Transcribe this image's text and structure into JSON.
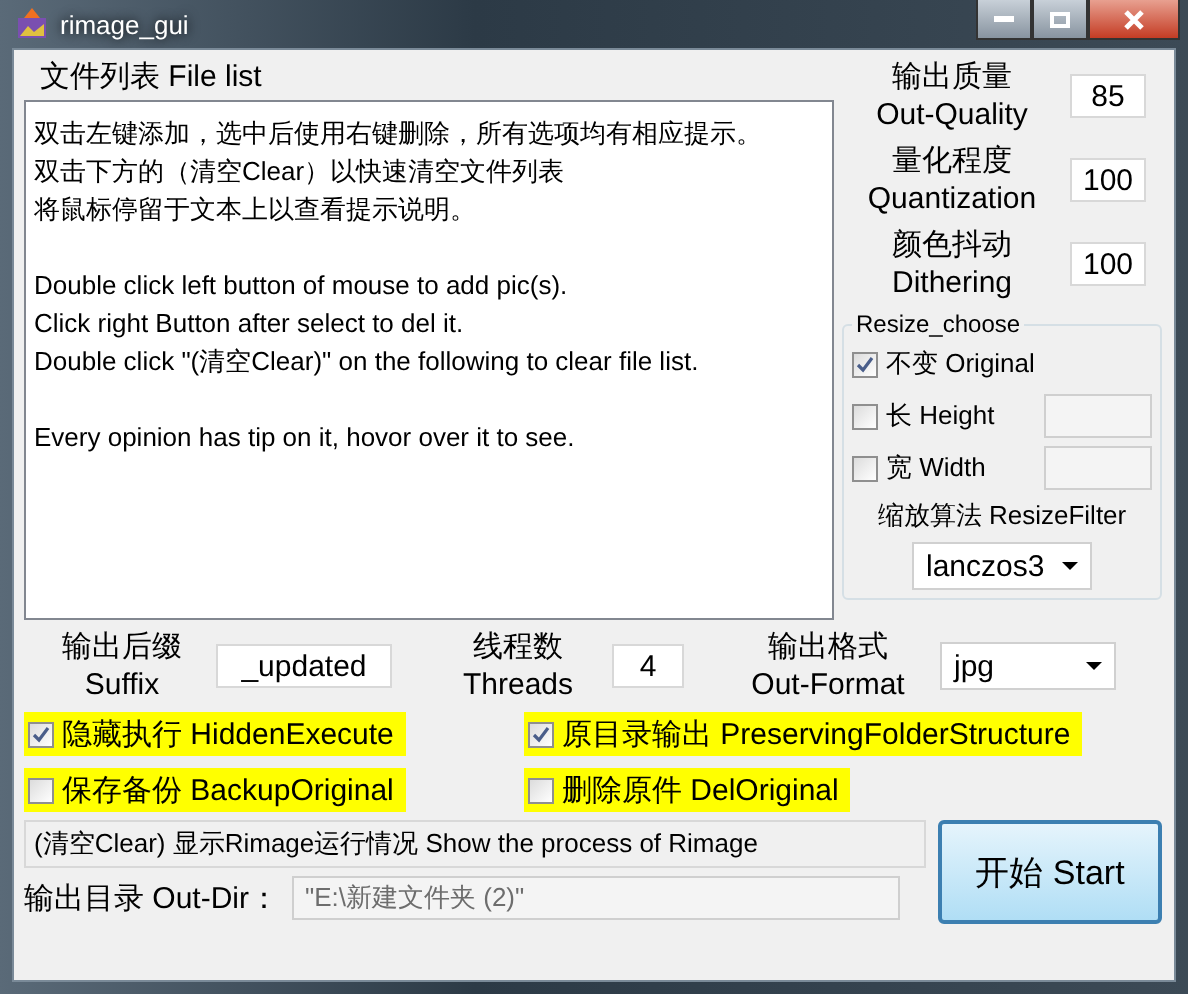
{
  "window": {
    "title": "rimage_gui"
  },
  "file_list": {
    "label": "文件列表 File list",
    "paragraphs": [
      [
        "双击左键添加，选中后使用右键删除，所有选项均有相应提示。",
        "双击下方的（清空Clear）以快速清空文件列表",
        "将鼠标停留于文本上以查看提示说明。"
      ],
      [
        "Double click left button of mouse to add pic(s).",
        "Click right Button after select to del it.",
        "Double click \"(清空Clear)\" on the following to clear file list."
      ],
      [
        "Every opinion has tip on it, hovor over it to see."
      ]
    ]
  },
  "params": [
    {
      "label_cn": "输出质量",
      "label_en": "Out-Quality",
      "value": "85"
    },
    {
      "label_cn": "量化程度",
      "label_en": "Quantization",
      "value": "100"
    },
    {
      "label_cn": "颜色抖动",
      "label_en": "Dithering",
      "value": "100"
    }
  ],
  "resize": {
    "title": "Resize_choose",
    "options": [
      {
        "label": "不变 Original",
        "checked": true,
        "kind": "plain"
      },
      {
        "label": "长 Height",
        "checked": false,
        "kind": "input"
      },
      {
        "label": "宽 Width",
        "checked": false,
        "kind": "input"
      }
    ],
    "filter_label": "缩放算法 ResizeFilter",
    "filter_value": "lanczos3"
  },
  "outputs": [
    {
      "label_cn": "输出后缀",
      "label_en": "Suffix",
      "value": "_updated",
      "kind": "input"
    },
    {
      "label_cn": "线程数",
      "label_en": "Threads",
      "value": "4",
      "kind": "input"
    },
    {
      "label_cn": "输出格式",
      "label_en": "Out-Format",
      "value": "jpg",
      "kind": "select"
    }
  ],
  "options": [
    {
      "label": "隐藏执行 HiddenExecute",
      "checked": true
    },
    {
      "label": "原目录输出 PreservingFolderStructure",
      "checked": true
    },
    {
      "label": "保存备份 BackupOriginal",
      "checked": false
    },
    {
      "label": "删除原件 DelOriginal",
      "checked": false
    }
  ],
  "status": "(清空Clear) 显示Rimage运行情况 Show the process of Rimage",
  "out_dir": {
    "label": "输出目录 Out-Dir：",
    "value": "\"E:\\新建文件夹 (2)\"",
    "disabled": true
  },
  "start_button": "开始 Start"
}
